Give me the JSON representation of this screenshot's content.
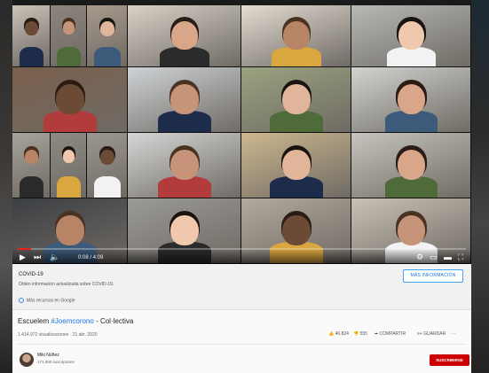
{
  "player": {
    "time": "0:08 / 4:09",
    "progress_fraction": 0.03
  },
  "covid_panel": {
    "title": "COVID-19",
    "description": "Obtén información actualizada sobre COVID-19.",
    "more_button": "MÁS INFORMACIÓN",
    "google_line": "Más recursos en Google"
  },
  "video": {
    "title_prefix": "Escuelem",
    "title_hashtag": "#Joemcorono",
    "title_suffix": " - Col·lectiva",
    "views": "1.414.972 visualizaciones · 21 abr. 2020",
    "likes": "46.824",
    "dislikes": "555",
    "share": "COMPARTIR",
    "save": "GUARDAR"
  },
  "channel": {
    "name": "Miki Núñez",
    "subscribers": "171.000 suscriptores",
    "subscribe_label": "SUSCRIBIRSE"
  },
  "colors": {
    "accent_red": "#cc0000",
    "link_blue": "#1a73e8",
    "progress_red": "#e62117"
  }
}
